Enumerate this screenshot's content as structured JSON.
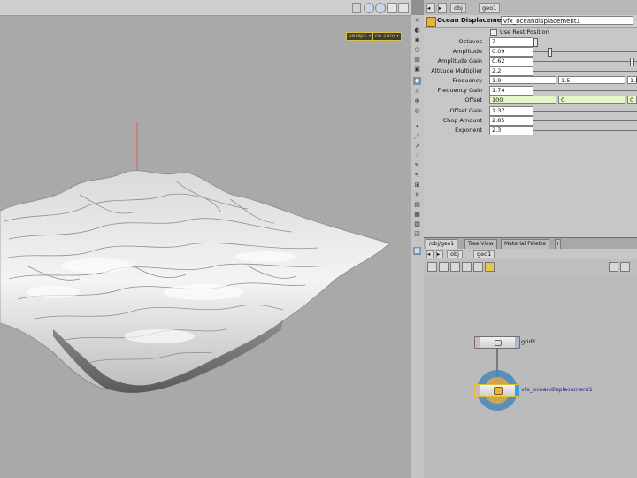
{
  "viewport": {
    "camera_badges": [
      "persp1 ▾",
      "no cam ▾"
    ]
  },
  "params": {
    "path": {
      "obj": "obj",
      "geo": "geo1"
    },
    "node_type": "Ocean Displacement",
    "node_name": "vfx_oceandisplacement1",
    "use_rest_label": "Use Rest Position",
    "rows": [
      {
        "label": "Octaves",
        "value": "7",
        "slider": 0.0
      },
      {
        "label": "Amplitude",
        "value": "0.09",
        "slider": 0.14
      },
      {
        "label": "Amplitude Gain",
        "value": "0.62",
        "slider": 0.97
      },
      {
        "label": "Altitude Multiplier",
        "value": "2.2",
        "slider": 0.0
      }
    ],
    "frequency": {
      "label": "Frequency",
      "values": [
        "1.9",
        "1.5",
        "1.5"
      ]
    },
    "frequency_gain": {
      "label": "Frequency Gain",
      "value": "1.74"
    },
    "offset": {
      "label": "Offset",
      "values": [
        "100",
        "0",
        "0"
      ]
    },
    "rows2": [
      {
        "label": "Offset Gain",
        "value": "1.37"
      },
      {
        "label": "Chop Amount",
        "value": "2.85"
      },
      {
        "label": "Exponent",
        "value": "2.3"
      }
    ]
  },
  "network": {
    "tabs": [
      "/obj/geo1",
      "Tree View",
      "Material Palette"
    ],
    "path": {
      "obj": "obj",
      "geo": "geo1"
    },
    "nodes": [
      {
        "name": "grid1"
      },
      {
        "name": "vfx_oceandisplacement1"
      }
    ]
  },
  "colors": {
    "viewport_bg": "#a9a9a9",
    "badge_text": "#d8c247",
    "highlight_field": "#e6f6c8",
    "selected_ring": "#4a86b8",
    "node_icon": "#e6b43a"
  }
}
